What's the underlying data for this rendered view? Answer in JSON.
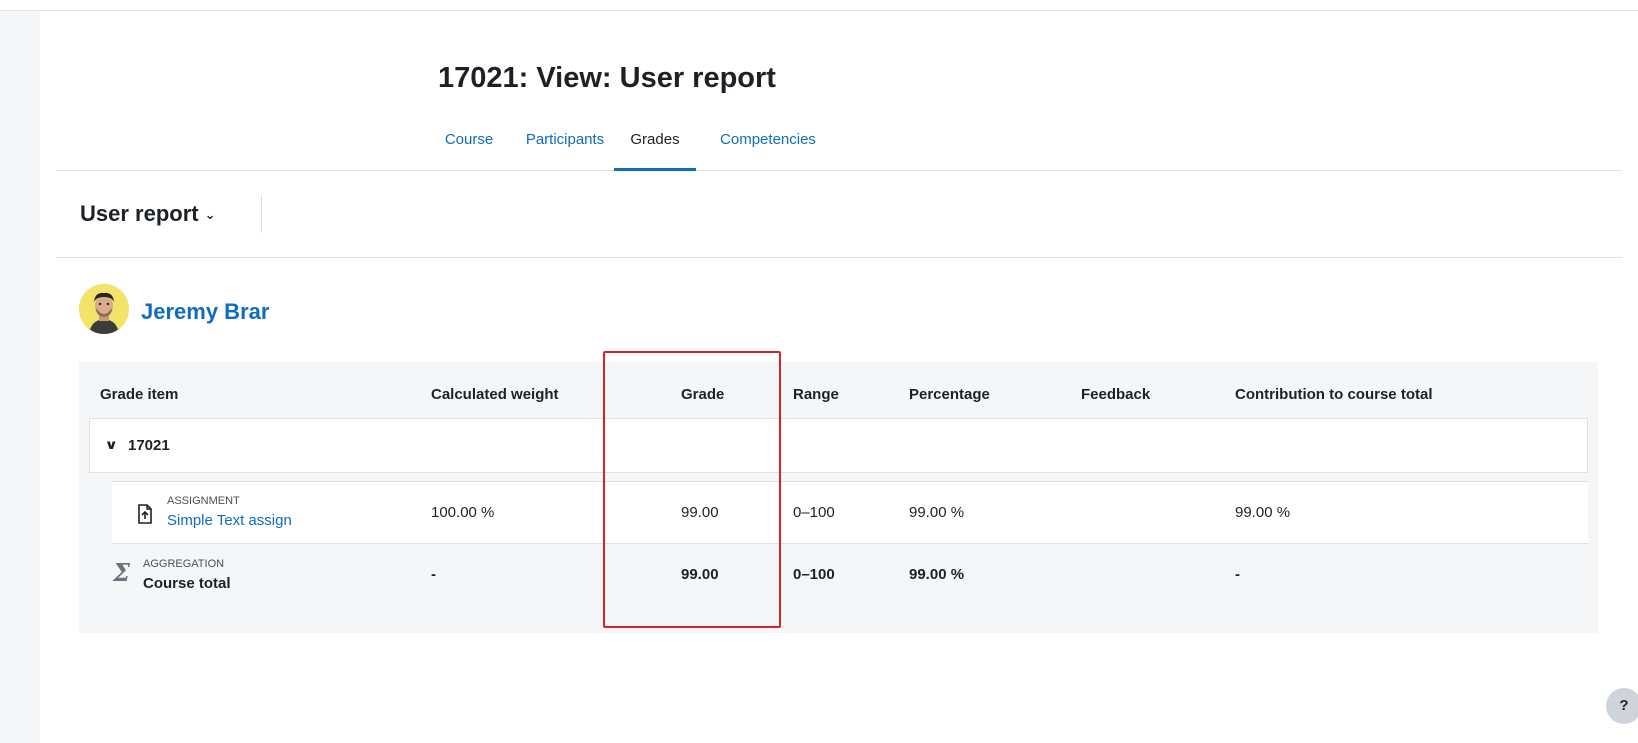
{
  "page": {
    "title": "17021: View: User report"
  },
  "tabs": [
    {
      "label": "Course",
      "active": false
    },
    {
      "label": "Participants",
      "active": false
    },
    {
      "label": "Grades",
      "active": true
    },
    {
      "label": "Competencies",
      "active": false
    }
  ],
  "report_selector": {
    "label": "User report"
  },
  "user": {
    "name": "Jeremy Brar"
  },
  "table": {
    "columns": [
      "Grade item",
      "Calculated weight",
      "Grade",
      "Range",
      "Percentage",
      "Feedback",
      "Contribution to course total"
    ],
    "category": {
      "name": "17021"
    },
    "item": {
      "type": "ASSIGNMENT",
      "name": "Simple Text assign",
      "weight": "100.00 %",
      "grade": "99.00",
      "range": "0–100",
      "percentage": "99.00 %",
      "feedback": "",
      "contribution": "99.00 %"
    },
    "total": {
      "type": "AGGREGATION",
      "name": "Course total",
      "weight": "-",
      "grade": "99.00",
      "range": "0–100",
      "percentage": "99.00 %",
      "feedback": "",
      "contribution": "-"
    }
  },
  "help": {
    "label": "?"
  },
  "colors": {
    "link": "#0f6cbf",
    "highlight": "#d9232b",
    "table_bg": "#f5f6f8"
  }
}
